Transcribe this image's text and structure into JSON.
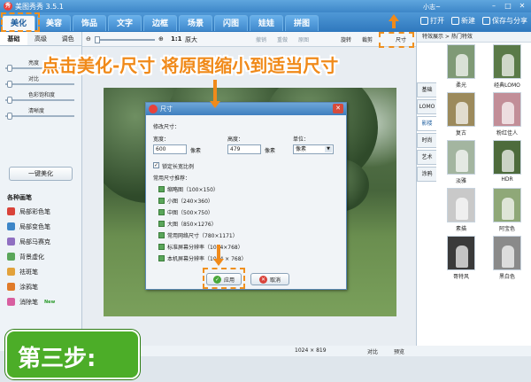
{
  "window": {
    "title": "美图秀秀 3.5.1",
    "user": "小志~",
    "buttons": [
      "minimize",
      "maximize",
      "close"
    ]
  },
  "menu": {
    "tabs": [
      "美化",
      "美容",
      "饰品",
      "文字",
      "边框",
      "场景",
      "闪图",
      "娃娃",
      "拼图"
    ],
    "active": "美化",
    "actions": {
      "open": "打开",
      "new": "新建",
      "save_share": "保存与分享"
    }
  },
  "left_panel": {
    "tabs": [
      "基础",
      "高级",
      "调色"
    ],
    "active_tab": "基础",
    "sliders": [
      "亮度",
      "对比",
      "色彩饱和度",
      "清晰度"
    ],
    "one_key_button": "一键美化",
    "brushes_title": "各种画笔",
    "brushes": [
      {
        "label": "局部彩色笔",
        "icon": "color-pen-icon",
        "color": "#d9433a"
      },
      {
        "label": "局部变色笔",
        "icon": "recolor-pen-icon",
        "color": "#3d86c8"
      },
      {
        "label": "局部马赛克",
        "icon": "mosaic-icon",
        "color": "#8f6fc1"
      },
      {
        "label": "背景虚化",
        "icon": "blur-icon",
        "color": "#5aa65a"
      },
      {
        "label": "祛斑笔",
        "icon": "spot-remover-icon",
        "color": "#e2a23b"
      },
      {
        "label": "涂鸦笔",
        "icon": "doodle-icon",
        "color": "#e07b2a"
      },
      {
        "label": "消除笔",
        "icon": "eraser-icon",
        "color": "#d85fa0",
        "badge": "New"
      }
    ]
  },
  "toolbar": {
    "zoom_ratio": "1:1",
    "original_size": "原大",
    "undo": "撤销",
    "redo": "重做",
    "original_image": "原图",
    "rotate": "旋转",
    "crop": "裁剪",
    "size": "尺寸"
  },
  "dialog": {
    "title": "尺寸",
    "section_title": "修改尺寸：",
    "width_label": "宽度：",
    "width_value": "600",
    "width_unit": "像素",
    "height_label": "高度：",
    "height_value": "479",
    "height_unit": "像素",
    "unit_label": "单位：",
    "unit_value": "像素",
    "lock_ratio_label": "锁定长宽比例",
    "lock_ratio_checked": true,
    "presets_title": "常用尺寸推荐：",
    "presets": [
      "缩略图（100×150）",
      "小图（240×360）",
      "中图（500×750）",
      "大图（850×1276）",
      "常用网络尺寸（780×1171）",
      "标准屏幕分辨率（1024×768）",
      "本机屏幕分辨率（1024 × 768）"
    ],
    "apply_button": "应用",
    "cancel_button": "取消"
  },
  "right_panel": {
    "header": "特效展示 > 热门特效",
    "categories": [
      "基础",
      "LOMO",
      "影楼",
      "时尚",
      "艺术",
      "涂鸦"
    ],
    "active_category": "影楼",
    "effects": [
      {
        "label": "柔光",
        "tint": "#7f9a76"
      },
      {
        "label": "经典LOMO",
        "tint": "#5a7a48"
      },
      {
        "label": "复古",
        "tint": "#9c8a5c"
      },
      {
        "label": "粉红佳人",
        "tint": "#c28e98"
      },
      {
        "label": "淡雅",
        "tint": "#a3b5a0"
      },
      {
        "label": "HDR",
        "tint": "#4d6b3c"
      },
      {
        "label": "素描",
        "tint": "#c9c9c9"
      },
      {
        "label": "阿宝色",
        "tint": "#8fa878"
      },
      {
        "label": "哥特风",
        "tint": "#3a3a3a"
      },
      {
        "label": "黑白色",
        "tint": "#8a8a8a"
      }
    ]
  },
  "statusbar": {
    "image_size": "1024 × 819",
    "compare": "对比",
    "preview": "预览"
  },
  "annotations": {
    "headline": "点击美化-尺寸 将原图缩小到适当尺寸",
    "step": "第三步:",
    "accent_color": "#f08a1a",
    "step_color": "#4cad28"
  }
}
